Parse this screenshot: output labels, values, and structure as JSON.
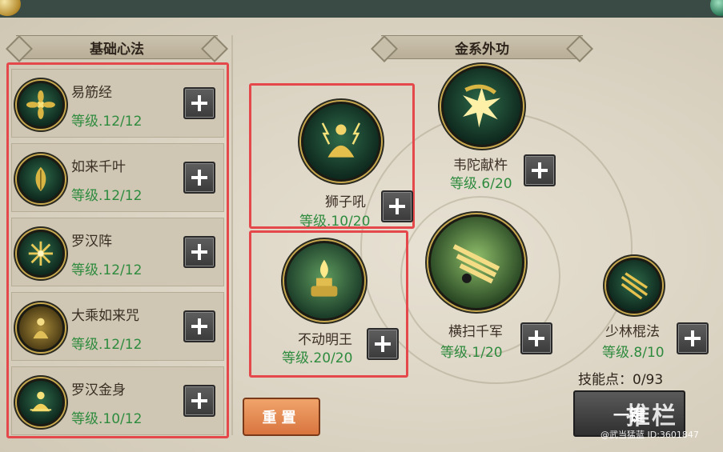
{
  "left_panel": {
    "title": "基础心法",
    "items": [
      {
        "name": "易筋经",
        "level": "等级.12/12",
        "icon": "golden-flower-icon"
      },
      {
        "name": "如来千叶",
        "level": "等级.12/12",
        "icon": "golden-leaf-icon"
      },
      {
        "name": "罗汉阵",
        "level": "等级.12/12",
        "icon": "golden-star-array-icon"
      },
      {
        "name": "大乘如来咒",
        "level": "等级.12/12",
        "icon": "golden-buddha-icon"
      },
      {
        "name": "罗汉金身",
        "level": "等级.10/12",
        "icon": "golden-arhat-icon"
      }
    ]
  },
  "right_panel": {
    "title": "金系外功",
    "skills": [
      {
        "name": "狮子吼",
        "level": "等级.10/20",
        "icon": "meditating-monk-lightning-icon"
      },
      {
        "name": "不动明王",
        "level": "等级.20/20",
        "icon": "golden-altar-flame-icon"
      },
      {
        "name": "韦陀献杵",
        "level": "等级.6/20",
        "icon": "golden-burst-icon"
      },
      {
        "name": "横扫千军",
        "level": "等级.1/20",
        "icon": "sweeping-staff-icon"
      },
      {
        "name": "少林棍法",
        "level": "等级.8/10",
        "icon": "staff-strike-icon"
      }
    ]
  },
  "skill_points": "技能点：0/93",
  "buttons": {
    "reset": "重置",
    "auto": "一键"
  },
  "watermark": {
    "text": "推栏",
    "id": "@武当猛蓝 ID:3601847"
  },
  "colors": {
    "level_green": "#2e8b3e",
    "highlight_red": "#e5484b",
    "reset_orange": "#e2854c"
  }
}
